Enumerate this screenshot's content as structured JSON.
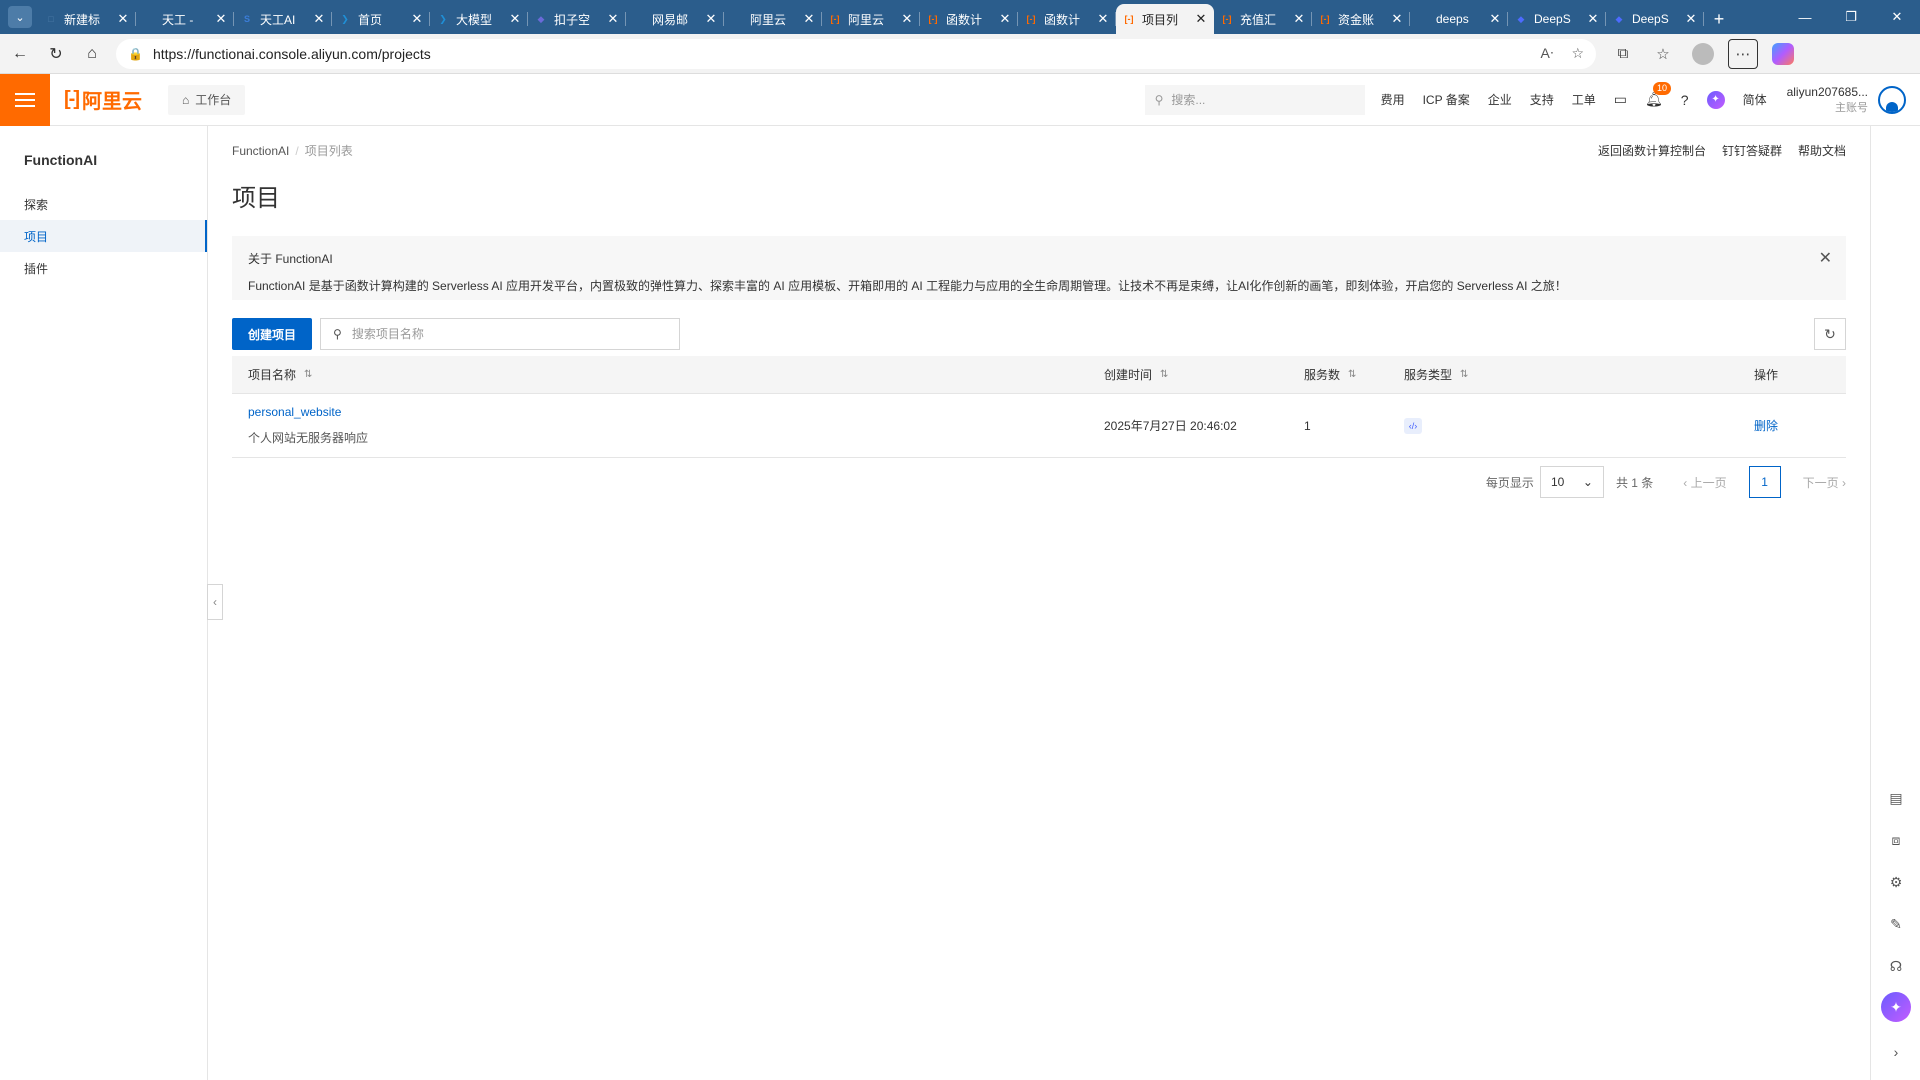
{
  "browser": {
    "tabs": [
      {
        "title": "新建标",
        "color": "#4d7ca8",
        "glyph": "□",
        "active": false
      },
      {
        "title": "天工 -",
        "color": "#2b5d8c",
        "glyph": "",
        "active": false
      },
      {
        "title": "天工AI",
        "color": "#3b7dd8",
        "glyph": "S",
        "active": false
      },
      {
        "title": "首页",
        "color": "#1f8fd6",
        "glyph": "❯",
        "active": false
      },
      {
        "title": "大模型",
        "color": "#1f8fd6",
        "glyph": "❯",
        "active": false
      },
      {
        "title": "扣子空",
        "color": "#6a6ad8",
        "glyph": "◆",
        "active": false
      },
      {
        "title": "网易邮",
        "color": "#2b5d8c",
        "glyph": "",
        "active": false
      },
      {
        "title": "阿里云",
        "color": "#2b5d8c",
        "glyph": "",
        "active": false
      },
      {
        "title": "阿里云",
        "color": "#ff6a00",
        "glyph": "[-]",
        "active": false
      },
      {
        "title": "函数计",
        "color": "#ff6a00",
        "glyph": "[-]",
        "active": false
      },
      {
        "title": "函数计",
        "color": "#ff6a00",
        "glyph": "[-]",
        "active": false
      },
      {
        "title": "项目列",
        "color": "#ff6a00",
        "glyph": "[-]",
        "active": true
      },
      {
        "title": "充值汇",
        "color": "#ff6a00",
        "glyph": "[-]",
        "active": false
      },
      {
        "title": "资金账",
        "color": "#ff6a00",
        "glyph": "[-]",
        "active": false
      },
      {
        "title": "deeps",
        "color": "#2b5d8c",
        "glyph": "",
        "active": false
      },
      {
        "title": "DeepS",
        "color": "#4d6bfe",
        "glyph": "◆",
        "active": false
      },
      {
        "title": "DeepS",
        "color": "#4d6bfe",
        "glyph": "◆",
        "active": false
      }
    ],
    "url": "https://functionai.console.aliyun.com/projects"
  },
  "console": {
    "brand": "阿里云",
    "workbench": "工作台",
    "search_placeholder": "搜索...",
    "links": [
      "费用",
      "ICP 备案",
      "企业",
      "支持",
      "工单"
    ],
    "notification_count": "10",
    "lang": "简体",
    "account_name": "aliyun207685...",
    "account_role": "主账号"
  },
  "sidebar": {
    "product": "FunctionAI",
    "items": [
      {
        "label": "探索",
        "active": false
      },
      {
        "label": "项目",
        "active": true
      },
      {
        "label": "插件",
        "active": false
      }
    ]
  },
  "main": {
    "breadcrumb": {
      "root": "FunctionAI",
      "current": "项目列表"
    },
    "top_actions": [
      "返回函数计算控制台",
      "钉钉答疑群",
      "帮助文档"
    ],
    "title": "项目",
    "info": {
      "title": "关于 FunctionAI",
      "text": "FunctionAI 是基于函数计算构建的 Serverless AI 应用开发平台，内置极致的弹性算力、探索丰富的 AI 应用模板、开箱即用的 AI 工程能力与应用的全生命周期管理。让技术不再是束缚，让AI化作创新的画笔，即刻体验，开启您的 Serverless AI 之旅！"
    },
    "create_button": "创建项目",
    "search_placeholder": "搜索项目名称",
    "table": {
      "headers": {
        "name": "项目名称",
        "time": "创建时间",
        "count": "服务数",
        "type": "服务类型",
        "op": "操作"
      },
      "rows": [
        {
          "name": "personal_website",
          "desc": "个人网站无服务器响应",
          "time": "2025年7月27日 20:46:02",
          "count": "1",
          "type_icon": "‹/›",
          "action": "删除"
        }
      ]
    },
    "pagination": {
      "page_size_label": "每页显示",
      "page_size": "10",
      "total": "共 1 条",
      "prev": "上一页",
      "current": "1",
      "next": "下一页"
    }
  }
}
